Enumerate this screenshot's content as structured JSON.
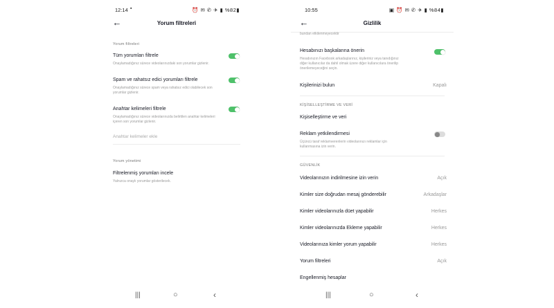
{
  "left": {
    "status": {
      "time": "12:14",
      "msg_icon": "chat-icon",
      "icons_text": "⏰ ✉ ✆ ✈ ▮ %82▮"
    },
    "title": "Yorum filtreleri",
    "section1_label": "Yorum filtreleri",
    "items": [
      {
        "title": "Tüm yorumları filtrele",
        "desc": "Onaylamadığınız sürece videolarınızdaki son yorumlar gizlenir.",
        "toggle": "on"
      },
      {
        "title": "Spam ve rahatsız edici yorumları filtrele",
        "desc1": "Onaylamadığınız sürece spam veya rahatsız edici olabilecek son",
        "desc2": "yorumlar gizlenir.",
        "toggle": "on"
      },
      {
        "title": "Anahtar kelimeleri filtrele",
        "desc1": "Onaylamadığınız sürece videolarınızda belirtilen anahtar kelimeleri",
        "desc2": "içeren son yorumlar gizlenir.",
        "toggle": "on"
      }
    ],
    "keyword_placeholder": "Anahtar kelimeler ekle",
    "section2_label": "Yorum yönetimi",
    "manage_title": "Filtrelenmiş yorumları incele",
    "manage_desc": "Yalnızca onaylı yorumlar gösterilecek."
  },
  "right": {
    "status": {
      "time": "10:55",
      "icons_text": "▣ ⏰ ✉ ✆ ✈ ▮ %84▮"
    },
    "title": "Gizlilik",
    "top_cut_text": "bundan etkilenmeyecektir",
    "suggest_title": "Hesabınızı başkalarına önerin",
    "suggest_desc1": "Hesabınızın Facebook arkadaşlarınız, kişileriniz veya tanıdığınız",
    "suggest_desc2": "diğer kullanıcılar da dahil olmak üzere diğer kullanıcılara önerilip",
    "suggest_desc3": "önerilemeyeceğini seçin.",
    "find_title": "Kişilerinizi bulun",
    "find_value": "Kapalı",
    "section_personal": "KİŞİSELLEŞTİRME VE VERİ",
    "personal_title": "Kişiselleştirme ve veri",
    "ads_title": "Reklam yetkilendirmesi",
    "ads_desc1": "Üçüncü taraf reklamverenlerin videolarınızı reklamlar için",
    "ads_desc2": "kullanmasına izin verin.",
    "section_safety": "GÜVENLİK",
    "rows": [
      {
        "title": "Videolarınızın indirilmesine izin verin",
        "value": "Açık"
      },
      {
        "title": "Kimler size doğrudan mesaj gönderebilir",
        "value": "Arkadaşlar"
      },
      {
        "title": "Kimler videolarınızla düet yapabilir",
        "value": "Herkes"
      },
      {
        "title": "Kimler videolarınızda Ekleme yapabilir",
        "value": "Herkes"
      },
      {
        "title": "Videolarınıza kimler yorum yapabilir",
        "value": "Herkes"
      },
      {
        "title": "Yorum filtreleri",
        "value": "Açık"
      },
      {
        "title": "Engellenmiş hesaplar",
        "value": ""
      }
    ]
  },
  "nav": {
    "recents": "|||",
    "home": "○",
    "back": "‹"
  },
  "colors": {
    "toggle_on": "#4ec16a",
    "toggle_off": "#dddddd"
  }
}
